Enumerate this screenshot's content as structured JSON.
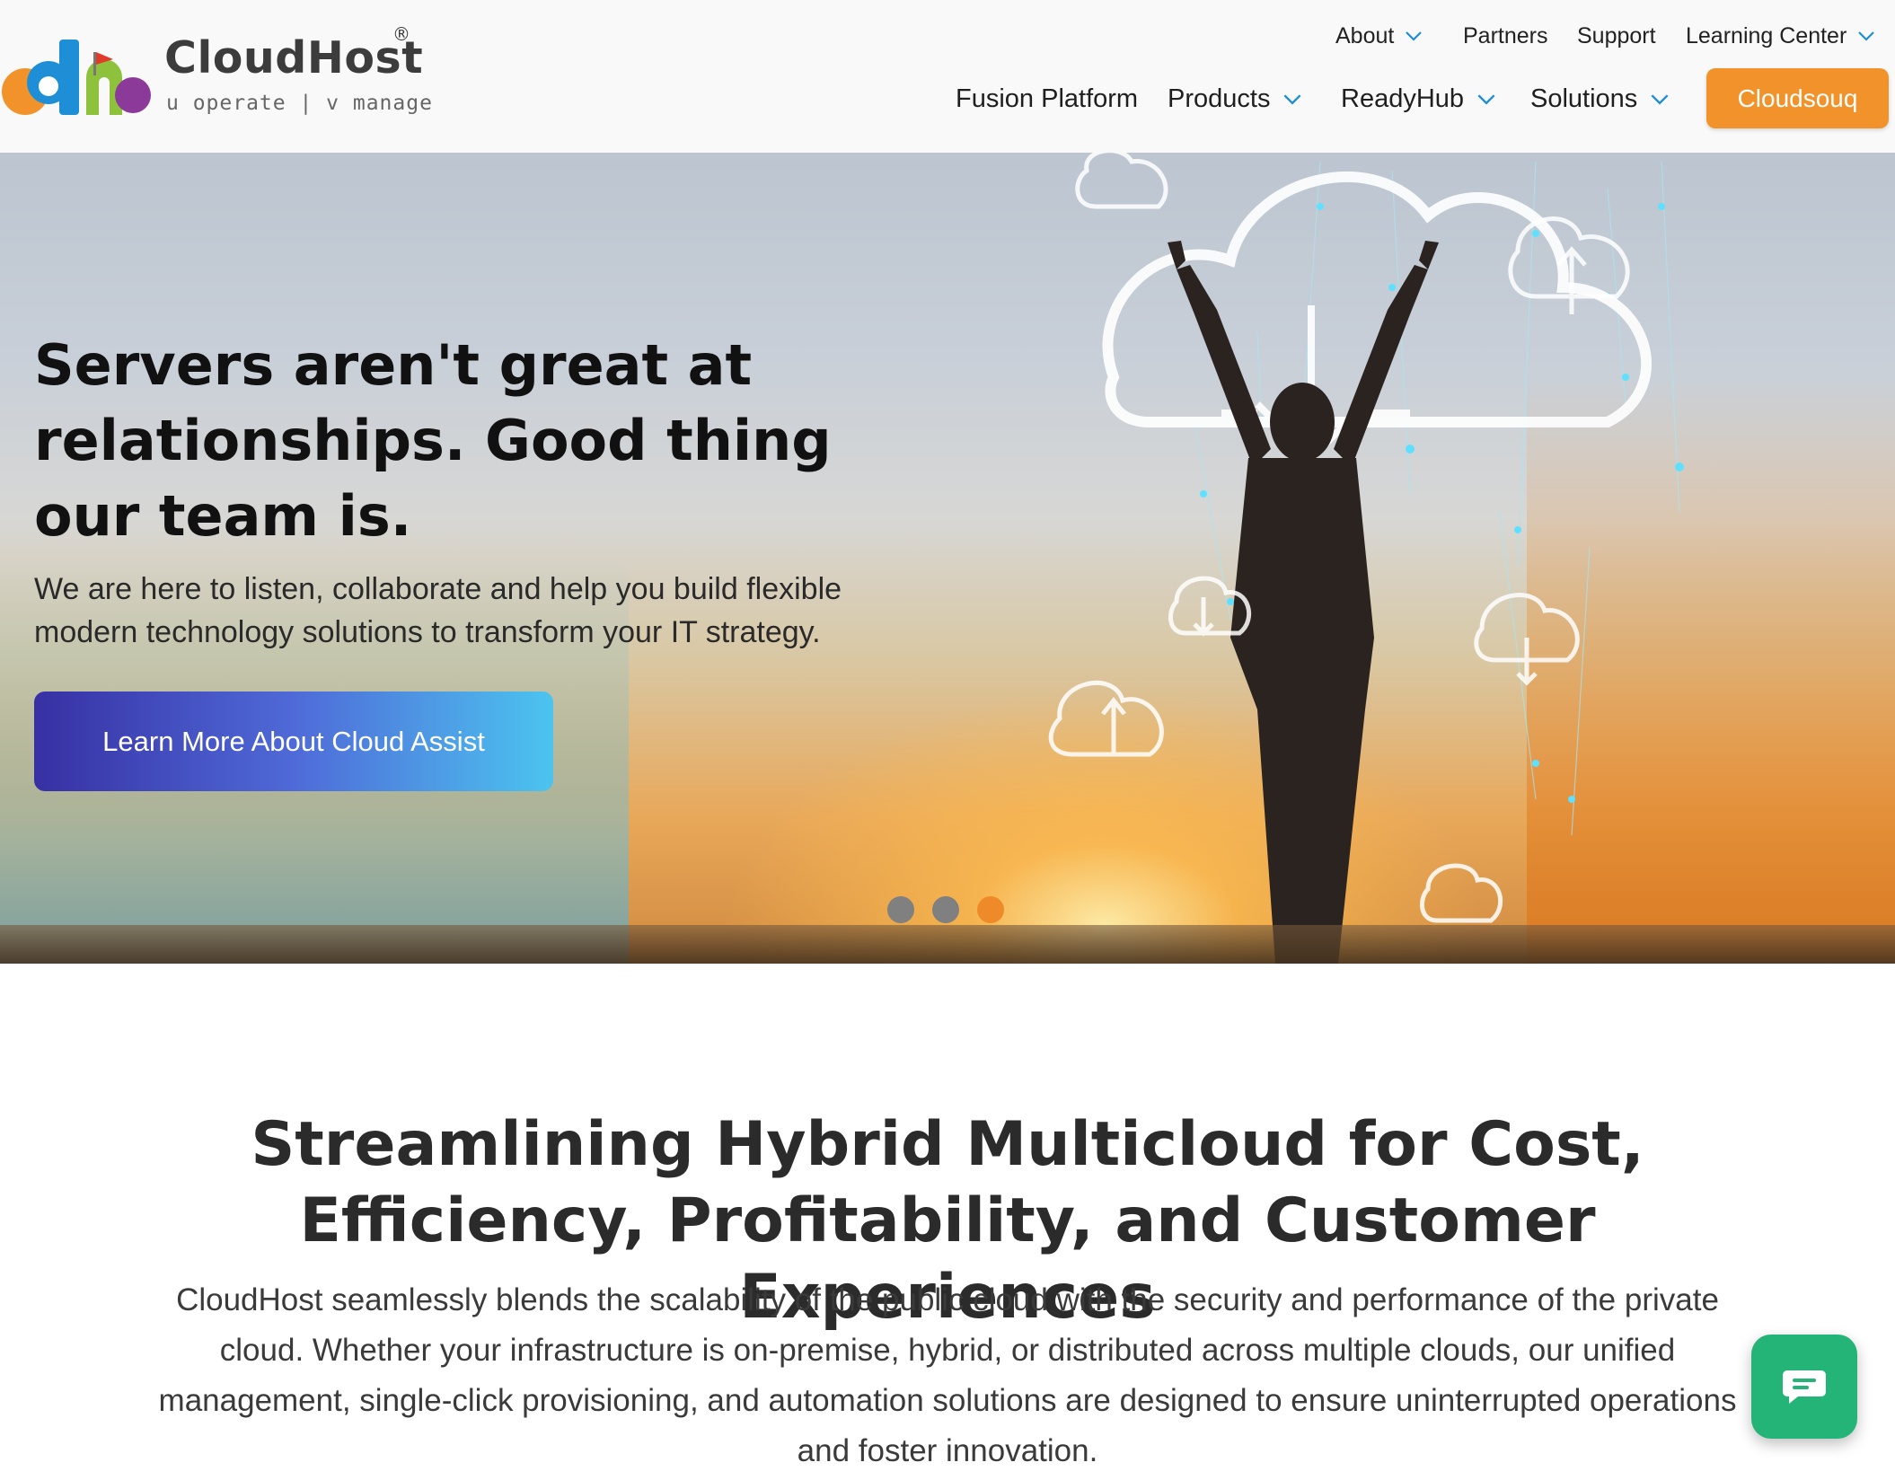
{
  "brand": {
    "name": "CloudHost",
    "registered": "®",
    "tagline": "u operate | v manage",
    "colors": {
      "orange": "#f1932a",
      "blue": "#1e8fd6",
      "green": "#8fc23c",
      "purple": "#8b3a9a",
      "red": "#e03b2a"
    }
  },
  "utility_nav": [
    {
      "label": "About",
      "has_dropdown": true
    },
    {
      "label": "Partners",
      "has_dropdown": false
    },
    {
      "label": "Support",
      "has_dropdown": false
    },
    {
      "label": "Learning Center",
      "has_dropdown": true
    }
  ],
  "main_nav": [
    {
      "label": "Fusion Platform",
      "has_dropdown": false
    },
    {
      "label": "Products",
      "has_dropdown": true
    },
    {
      "label": "ReadyHub",
      "has_dropdown": true
    },
    {
      "label": "Solutions",
      "has_dropdown": true
    }
  ],
  "cta_top": {
    "label": "Cloudsouq",
    "color": "#f1932a"
  },
  "hero": {
    "headline": "Servers aren't great at relationships. Good thing our team is.",
    "subtext": "We are here to listen, collaborate and help you build flexible modern technology solutions to transform your IT strategy.",
    "cta_label": "Learn More About Cloud Assist",
    "slides": {
      "count": 3,
      "active_index": 2,
      "inactive_color": "#808080",
      "active_color": "#ef8a2a"
    }
  },
  "section": {
    "title": "Streamlining Hybrid Multicloud for Cost, Efficiency, Profitability, and Customer Experiences",
    "body": "CloudHost seamlessly blends the scalability of the public cloud with the security and performance of the private cloud. Whether your infrastructure is on-premise, hybrid, or distributed across multiple clouds, our unified management, single-click provisioning, and automation solutions are designed to ensure uninterrupted operations and foster innovation."
  },
  "chat_widget": {
    "icon": "chat-bubble-icon",
    "color": "#25b477"
  }
}
